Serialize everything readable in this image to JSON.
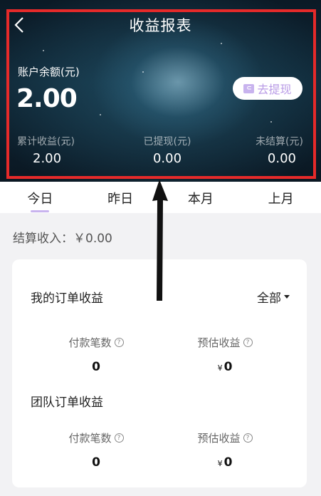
{
  "header": {
    "title": "收益报表",
    "balance_label": "账户余额(元)",
    "balance_value": "2.00",
    "withdraw_label": "去提现",
    "stats": [
      {
        "label": "累计收益(元)",
        "value": "2.00"
      },
      {
        "label": "已提现(元)",
        "value": "0.00"
      },
      {
        "label": "未结算(元)",
        "value": "0.00"
      }
    ]
  },
  "tabs": [
    {
      "label": "今日",
      "active": true
    },
    {
      "label": "昨日"
    },
    {
      "label": "本月"
    },
    {
      "label": "上月"
    }
  ],
  "settlement": "结算收入：￥0.00",
  "card": {
    "section1_title": "我的订单收益",
    "filter_label": "全部",
    "section2_title": "团队订单收益",
    "my_orders": {
      "count_label": "付款笔数",
      "count_value": "0",
      "estimate_label": "预估收益",
      "estimate_currency": "¥",
      "estimate_value": "0"
    },
    "team_orders": {
      "count_label": "付款笔数",
      "count_value": "0",
      "estimate_label": "预估收益",
      "estimate_currency": "¥",
      "estimate_value": "0"
    }
  },
  "colors": {
    "accent": "#c8b3ee",
    "highlight_box": "#e62a2a"
  },
  "icons": [
    "back-icon",
    "wallet-icon",
    "question-icon",
    "caret-down-icon",
    "arrow-annotation"
  ]
}
